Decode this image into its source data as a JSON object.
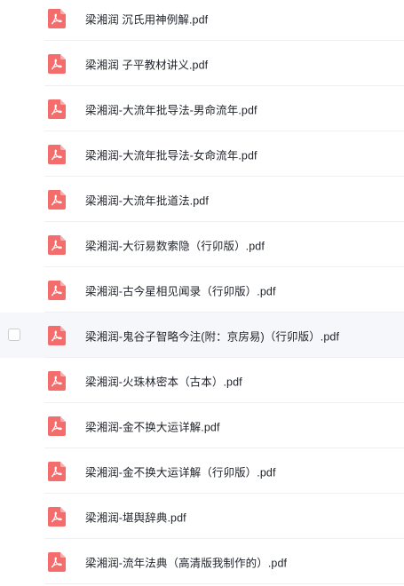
{
  "files": [
    {
      "name": "梁湘润 沉氏用神例解.pdf",
      "icon": "pdf-file-icon"
    },
    {
      "name": "梁湘润 子平教材讲义.pdf",
      "icon": "pdf-file-icon"
    },
    {
      "name": "梁湘润-大流年批导法-男命流年.pdf",
      "icon": "pdf-file-icon"
    },
    {
      "name": "梁湘润-大流年批导法-女命流年.pdf",
      "icon": "pdf-file-icon"
    },
    {
      "name": "梁湘润-大流年批道法.pdf",
      "icon": "pdf-file-icon"
    },
    {
      "name": "梁湘润-大衍易数索隐（行卯版）.pdf",
      "icon": "pdf-file-icon"
    },
    {
      "name": "梁湘润-古今星相见闻录（行卯版）.pdf",
      "icon": "pdf-file-icon"
    },
    {
      "name": "梁湘润-鬼谷子智略今注(附：京房易)（行卯版）.pdf",
      "icon": "pdf-file-icon"
    },
    {
      "name": "梁湘润-火珠林密本（古本）.pdf",
      "icon": "pdf-file-icon"
    },
    {
      "name": "梁湘润-金不换大运详解.pdf",
      "icon": "pdf-file-icon"
    },
    {
      "name": "梁湘润-金不换大运详解（行卯版）.pdf",
      "icon": "pdf-file-icon"
    },
    {
      "name": "梁湘润-堪舆辞典.pdf",
      "icon": "pdf-file-icon"
    },
    {
      "name": "梁湘润-流年法典（高清版我制作的）.pdf",
      "icon": "pdf-file-icon"
    }
  ],
  "hovered_index": 7,
  "colors": {
    "pdf_icon": "#f46d6d",
    "hover_row": "#f6f7fa",
    "text": "#1f2329",
    "divider": "#f0f0f3"
  }
}
